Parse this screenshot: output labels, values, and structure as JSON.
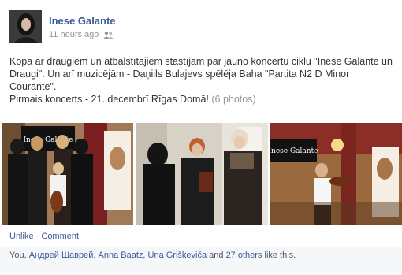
{
  "post": {
    "author_name": "Inese Galante",
    "timestamp": "11 hours ago",
    "audience_icon": "friends-icon",
    "text_line1": "Kopā ar draugiem un atbalstītājiem stāstījām par jauno koncertu ciklu \"Inese Galante un Draugi\". Un arī muzicējām - Daņiils Bulajevs spēlēja Baha \"Partita N2 D Minor Courante\".",
    "text_line2": "Pirmais koncerts - 21. decembrī Rīgas Domā!",
    "photos_count": "(6 photos)"
  },
  "photos": {
    "photo1_poster_text": "Inese Galante",
    "photo3_poster_text": "Inese Galante"
  },
  "actions": {
    "unlike": "Unlike",
    "separator": "·",
    "comment": "Comment"
  },
  "likes": {
    "prefix": "You, ",
    "person1": "Андрей Шаврей",
    "sep1": ", ",
    "person2": "Anna Baatz",
    "sep2": ", ",
    "person3": "Una Griškeviča",
    "and": " and ",
    "others": "27 others",
    "suffix": " like this."
  },
  "colors": {
    "link": "#3b5998",
    "muted": "#9197a3",
    "text": "#333333"
  }
}
